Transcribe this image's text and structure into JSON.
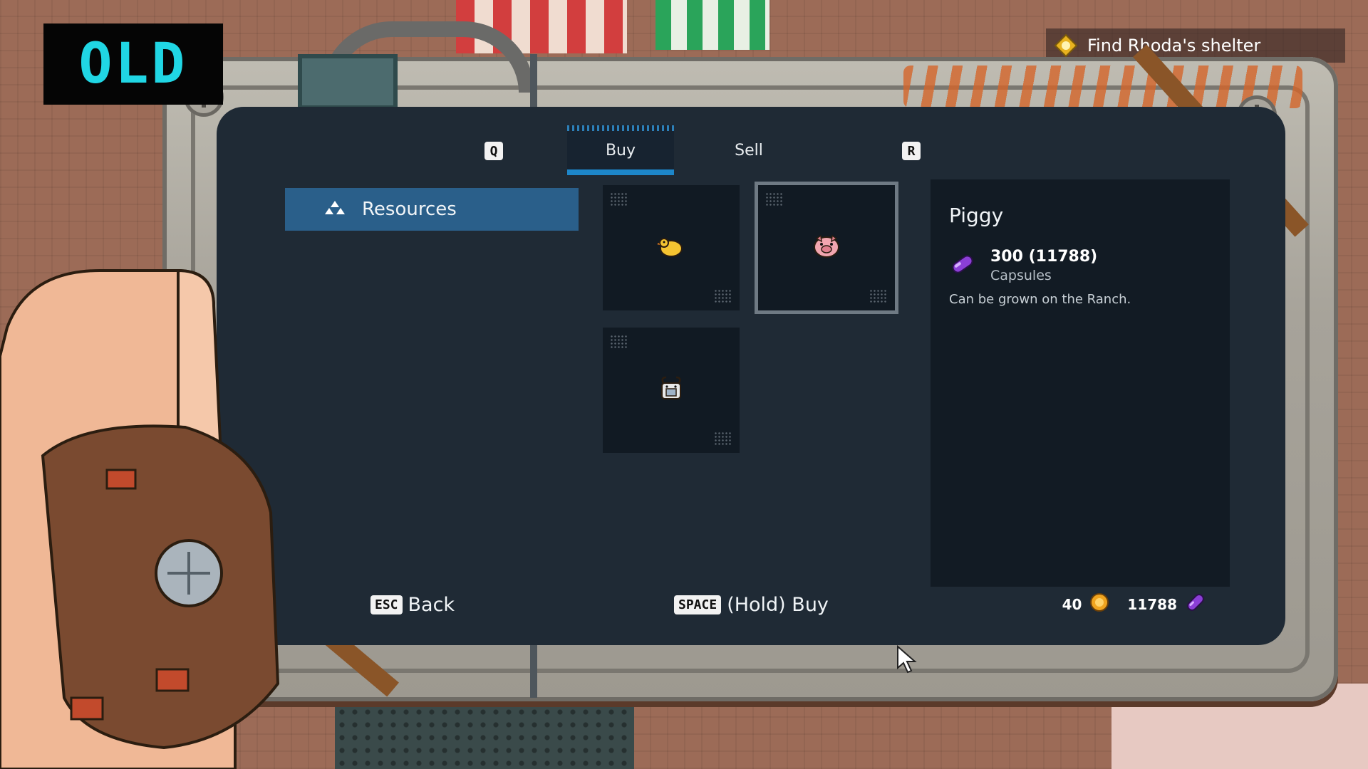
{
  "overlay_label": "OLD",
  "quest": {
    "text": "Find Rhoda's shelter",
    "icon": "quest-marker-icon"
  },
  "tabs": {
    "prev_key": "Q",
    "next_key": "R",
    "items": [
      {
        "label": "Buy",
        "active": true
      },
      {
        "label": "Sell",
        "active": false
      }
    ]
  },
  "categories": [
    {
      "label": "Resources",
      "icon": "resources-icon",
      "selected": true
    }
  ],
  "items": [
    {
      "icon": "chick-icon",
      "selected": false
    },
    {
      "icon": "piggy-icon",
      "selected": true
    },
    {
      "icon": "goat-icon",
      "selected": false
    }
  ],
  "detail": {
    "name": "Piggy",
    "price": "300 (11788)",
    "currency": "Capsules",
    "description": "Can be grown on the Ranch."
  },
  "footer": {
    "back_key": "ESC",
    "back_label": "Back",
    "buy_key": "SPACE",
    "buy_label": "(Hold) Buy"
  },
  "wallet": {
    "coins": "40",
    "capsules": "11788"
  },
  "colors": {
    "accent": "#1d86c9",
    "screen": "#1f2a35",
    "overlay_text": "#20d6e4"
  }
}
